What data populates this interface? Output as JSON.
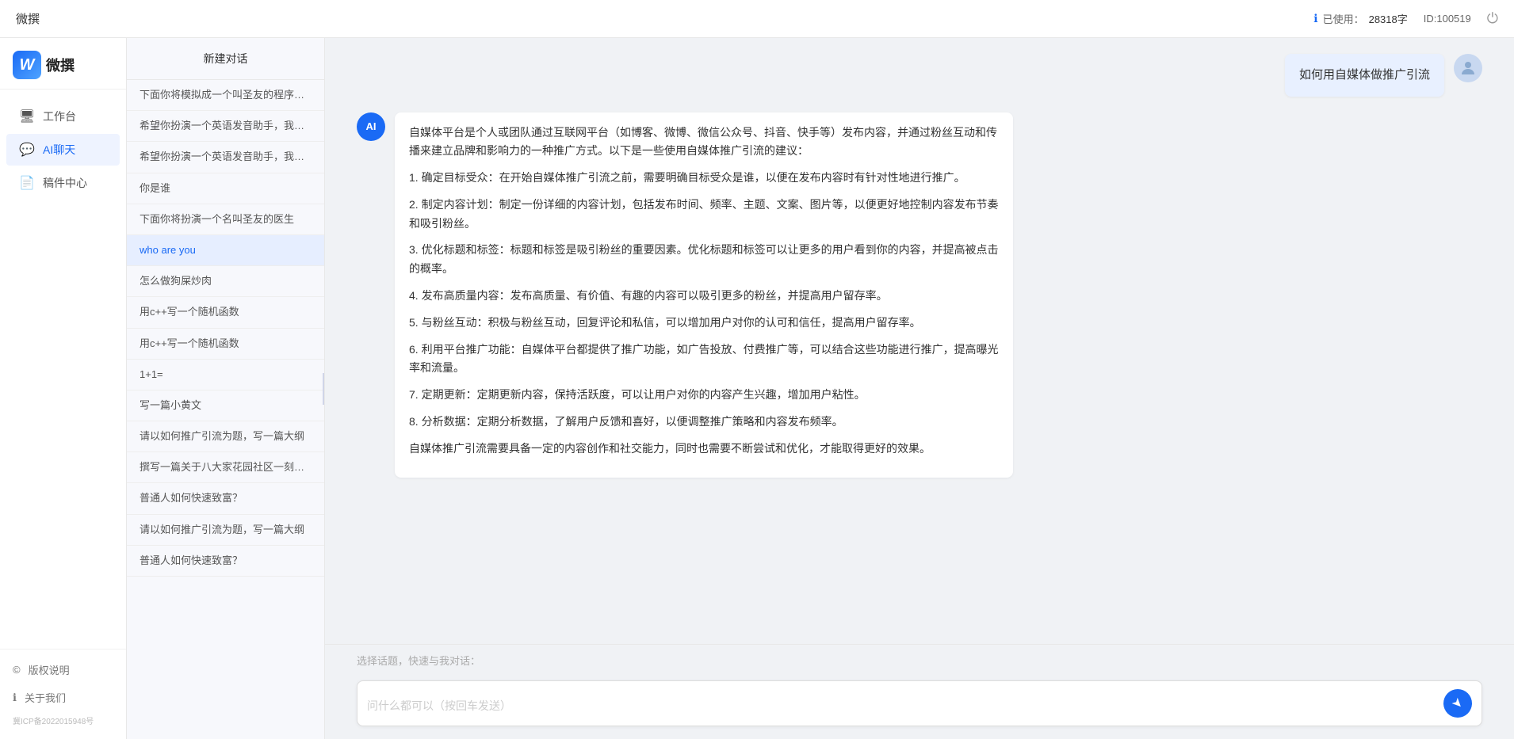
{
  "topbar": {
    "title": "微撰",
    "usage_label": "已使用：",
    "usage_value": "28318字",
    "id_label": "ID:100519"
  },
  "sidebar": {
    "logo_letter": "W",
    "logo_name": "微撰",
    "nav_items": [
      {
        "id": "workspace",
        "label": "工作台",
        "icon": "🖥"
      },
      {
        "id": "ai-chat",
        "label": "AI聊天",
        "icon": "💬",
        "active": true
      },
      {
        "id": "drafts",
        "label": "稿件中心",
        "icon": "📄"
      }
    ],
    "footer_items": [
      {
        "id": "copyright",
        "label": "版权说明",
        "icon": "©"
      },
      {
        "id": "about",
        "label": "关于我们",
        "icon": "ℹ"
      }
    ],
    "icp": "冀ICP备2022015948号"
  },
  "chat_list": {
    "header": "新建对话",
    "items": [
      {
        "id": 1,
        "text": "下面你将模拟成一个叫圣友的程序员，我说..."
      },
      {
        "id": 2,
        "text": "希望你扮演一个英语发音助手，我提供给你..."
      },
      {
        "id": 3,
        "text": "希望你扮演一个英语发音助手，我提供给你..."
      },
      {
        "id": 4,
        "text": "你是谁",
        "active": true
      },
      {
        "id": 5,
        "text": "下面你将扮演一个名叫圣友的医生"
      },
      {
        "id": 6,
        "text": "who are you"
      },
      {
        "id": 7,
        "text": "怎么做狗屎炒肉"
      },
      {
        "id": 8,
        "text": "用c++写一个随机函数"
      },
      {
        "id": 9,
        "text": "用c++写一个随机函数"
      },
      {
        "id": 10,
        "text": "1+1="
      },
      {
        "id": 11,
        "text": "写一篇小黄文"
      },
      {
        "id": 12,
        "text": "请以如何推广引流为题，写一篇大纲"
      },
      {
        "id": 13,
        "text": "撰写一篇关于八大家花园社区一刻钟便民生..."
      },
      {
        "id": 14,
        "text": "普通人如何快速致富？"
      },
      {
        "id": 15,
        "text": "请以如何推广引流为题，写一篇大纲"
      },
      {
        "id": 16,
        "text": "普通人如何快速致富？"
      }
    ]
  },
  "chat": {
    "user_question": "如何用自媒体做推广引流",
    "ai_response": {
      "paragraphs": [
        "自媒体平台是个人或团队通过互联网平台（如博客、微博、微信公众号、抖音、快手等）发布内容，并通过粉丝互动和传播来建立品牌和影响力的一种推广方式。以下是一些使用自媒体推广引流的建议：",
        "1. 确定目标受众：在开始自媒体推广引流之前，需要明确目标受众是谁，以便在发布内容时有针对性地进行推广。",
        "2. 制定内容计划：制定一份详细的内容计划，包括发布时间、频率、主题、文案、图片等，以便更好地控制内容发布节奏和吸引粉丝。",
        "3. 优化标题和标签：标题和标签是吸引粉丝的重要因素。优化标题和标签可以让更多的用户看到你的内容，并提高被点击的概率。",
        "4. 发布高质量内容：发布高质量、有价值、有趣的内容可以吸引更多的粉丝，并提高用户留存率。",
        "5. 与粉丝互动：积极与粉丝互动，回复评论和私信，可以增加用户对你的认可和信任，提高用户留存率。",
        "6. 利用平台推广功能：自媒体平台都提供了推广功能，如广告投放、付费推广等，可以结合这些功能进行推广，提高曝光率和流量。",
        "7. 定期更新：定期更新内容，保持活跃度，可以让用户对你的内容产生兴趣，增加用户粘性。",
        "8. 分析数据：定期分析数据，了解用户反馈和喜好，以便调整推广策略和内容发布频率。",
        "自媒体推广引流需要具备一定的内容创作和社交能力，同时也需要不断尝试和优化，才能取得更好的效果。"
      ]
    },
    "quick_bar_label": "选择话题，快速与我对话：",
    "input_placeholder": "问什么都可以（按回车发送）"
  }
}
